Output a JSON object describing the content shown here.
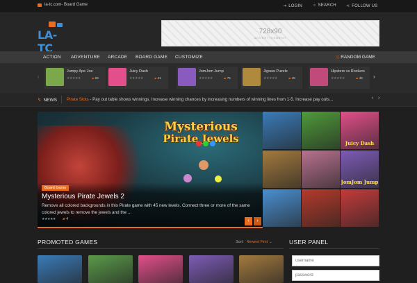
{
  "topbar": {
    "site_label": "la-tc.com- Board Game",
    "login": "LOGIN",
    "search": "SEARCH",
    "follow": "FOLLOW US"
  },
  "header": {
    "logo_text": "LA-TC",
    "ad_size": "728x90",
    "ad_sub": "ADVERTISEMENT"
  },
  "nav": {
    "items": [
      "ACTION",
      "ADVENTURE",
      "ARCADE",
      "BOARD GAME",
      "CUSTOMIZE"
    ],
    "random": "RANDOM GAME"
  },
  "carousel": [
    {
      "name": "Jumpy Ape Joe",
      "plays": "69",
      "thumb_color": "#7aa84a"
    },
    {
      "name": "Juicy Dash",
      "plays": "21",
      "thumb_color": "#e24f8a"
    },
    {
      "name": "JomJom Jump",
      "plays": "75",
      "thumb_color": "#8a5bbf"
    },
    {
      "name": "Jigsaw Puzzle",
      "plays": "45",
      "thumb_color": "#b08a3c"
    },
    {
      "name": "Hipsters vs Rockers",
      "plays": "48",
      "thumb_color": "#c04a7a"
    }
  ],
  "news": {
    "label": "NEWS",
    "headline": "Pirate Slots",
    "text": " - Pay out table shows winnings. Increase winning chances by increasing numbers of winning lines from 1-5. Increase pay outs..."
  },
  "featured": {
    "tag": "Board Game",
    "title": "Mysterious Pirate Jewels 2",
    "description": "Remove all colored backgrounds in this Pirate game with 45 new levels. Connect three or more of the same colored jewels to remove the jewels and the ...",
    "count": "4",
    "art_line1": "Mysterious",
    "art_line2": "Pirate Jewels",
    "prev": "‹",
    "next": "›"
  },
  "grid_tiles": [
    {
      "label": "",
      "color": "#3a7bb8"
    },
    {
      "label": "",
      "color": "#4f9a3a"
    },
    {
      "label": "Juicy Dash",
      "color": "#e24f8a"
    },
    {
      "label": "",
      "color": "#6fa8d6"
    },
    {
      "label": "",
      "color": "#a37a3e"
    },
    {
      "label": "",
      "color": "#b8728f"
    },
    {
      "label": "JomJom Jump",
      "color": "#7d5bb5"
    },
    {
      "label": "",
      "color": "#9a6b38"
    },
    {
      "label": "",
      "color": "#4a8fd0"
    },
    {
      "label": "",
      "color": "#b53a2a"
    },
    {
      "label": "",
      "color": "#c43b3b"
    },
    {
      "label": "",
      "color": "#3a7ab8"
    }
  ],
  "promoted": {
    "heading": "PROMOTED GAMES",
    "sort_label": "Sort:",
    "sort_value": "Newest First",
    "tiles": [
      "#3a7bb8",
      "#5a9a4a",
      "#e24f8a",
      "#7d5bb5",
      "#a37a3e"
    ]
  },
  "user_panel": {
    "heading": "USER PANEL",
    "username_placeholder": "username",
    "password_placeholder": "password"
  },
  "icons": {
    "login": "login-icon",
    "search": "search-icon",
    "follow": "share-icon",
    "random": "shuffle-icon",
    "news": "bolt-icon"
  },
  "colors": {
    "accent": "#e86d1f",
    "background": "#1f1f1f",
    "nav": "#3a3a3a"
  }
}
